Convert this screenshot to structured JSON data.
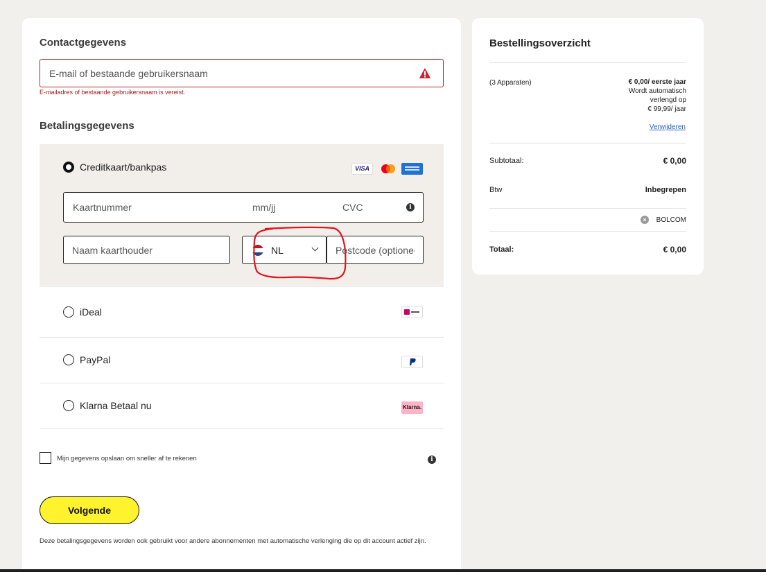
{
  "contact": {
    "heading": "Contactgegevens",
    "email_placeholder": "E-mail of bestaande gebruikersnaam",
    "email_error": "E-mailadres of bestaande gebruikersnaam is vereist."
  },
  "payment": {
    "heading": "Betalingsgegevens",
    "credit_card": {
      "label": "Creditkaart/bankpas",
      "selected": true,
      "card_number_placeholder": "Kaartnummer",
      "expiry_placeholder": "mm/jj",
      "cvc_placeholder": "CVC",
      "cardholder_placeholder": "Naam kaarthouder",
      "country_value": "NL",
      "postcode_placeholder": "Postcode (optioneel)",
      "brands": {
        "visa": "VISA"
      }
    },
    "options": [
      {
        "label": "iDeal",
        "logo": "ideal-wero-logo"
      },
      {
        "label": "PayPal",
        "logo": "paypal-logo"
      },
      {
        "label": "Klarna Betaal nu",
        "logo": "klarna-logo",
        "logo_text": "Klarna."
      }
    ],
    "save_details_label": "Mijn gegevens opslaan om sneller af te rekenen",
    "next_button": "Volgende",
    "footnote": "Deze betalingsgegevens worden ook gebruikt voor andere abonnementen met automatische verlenging die op dit account actief zijn."
  },
  "summary": {
    "heading": "Bestellingsoverzicht",
    "item_name": "(3 Apparaten)",
    "price_first_year": "€ 0,00/ eerste jaar",
    "renewal_line1": "Wordt automatisch",
    "renewal_line2": "verlengd op",
    "renewal_price": "€ 99,99/ jaar",
    "remove_link": "Verwijderen",
    "subtotal_label": "Subtotaal:",
    "subtotal_value": "€ 0,00",
    "vat_label": "Btw",
    "vat_value": "Inbegrepen",
    "coupon_code": "BOLCOM",
    "total_label": "Totaal:",
    "total_value": "€ 0,00"
  },
  "colors": {
    "accent_button": "#fff32d",
    "error": "#b3262d",
    "link": "#2b63b7",
    "panel_bg": "#f2efea",
    "annotation": "#e0141e"
  }
}
